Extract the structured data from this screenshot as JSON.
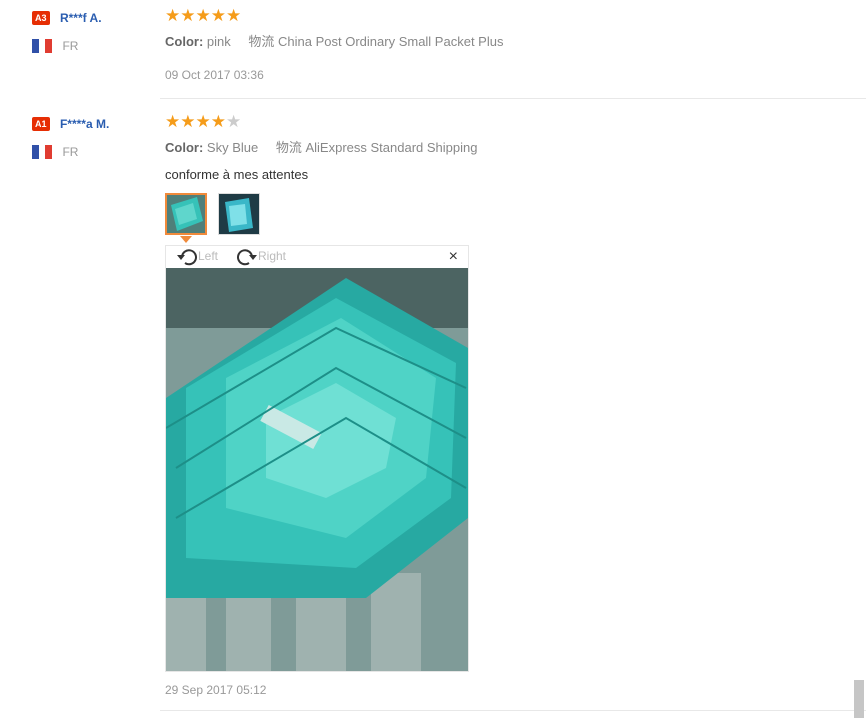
{
  "reviews": [
    {
      "badge": "A3",
      "name": "R***f A.",
      "country": "FR",
      "rating": 5,
      "color_label": "Color:",
      "color_value": "pink",
      "shipping_prefix": "物流",
      "shipping": "China Post Ordinary Small Packet Plus",
      "date": "09 Oct 2017 03:36"
    },
    {
      "badge": "A1",
      "name": "F****a M.",
      "country": "FR",
      "rating": 4,
      "color_label": "Color:",
      "color_value": "Sky Blue",
      "shipping_prefix": "物流",
      "shipping": "AliExpress Standard Shipping",
      "comment": "conforme à mes attentes",
      "date": "29 Sep 2017 05:12",
      "viewer": {
        "rotate_left": "Left",
        "rotate_right": "Right",
        "close": "×"
      }
    }
  ],
  "colors": {
    "badge": "#e62e04",
    "star": "#f59c1a",
    "link": "#2a5db0",
    "photo_accent": "#36c2b8"
  }
}
